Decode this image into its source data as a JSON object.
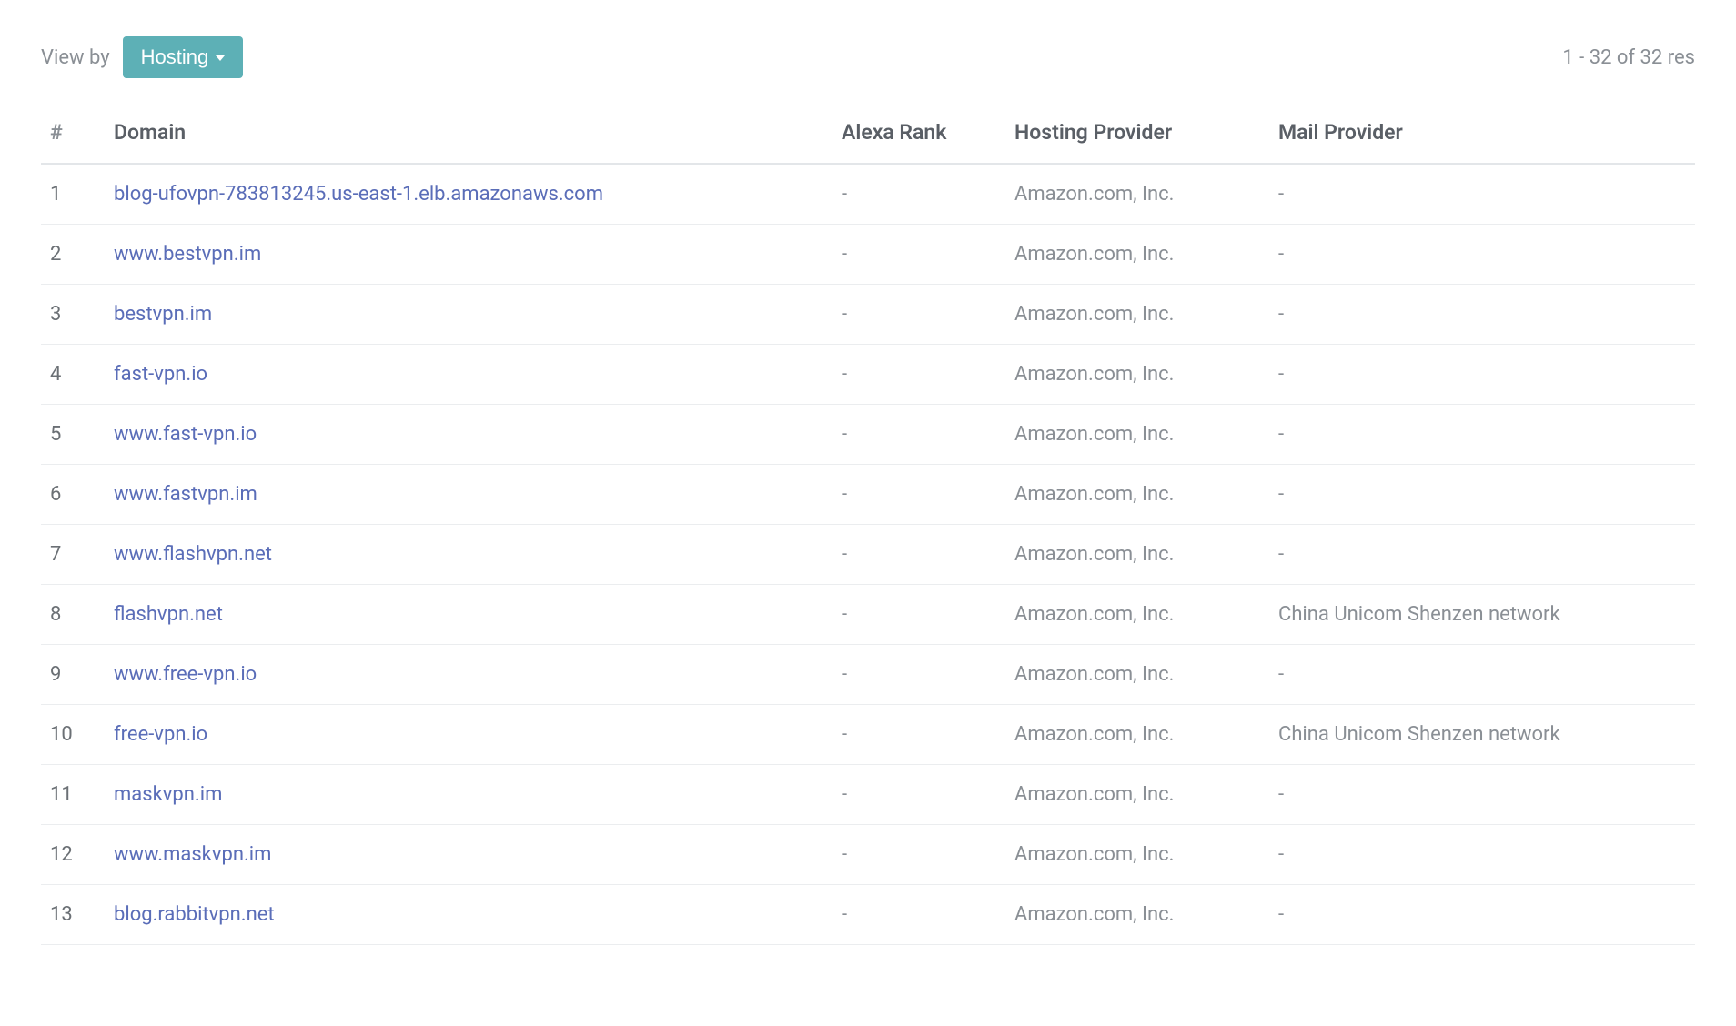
{
  "topbar": {
    "viewby_label": "View by",
    "dropdown_value": "Hosting",
    "result_count": "1 - 32 of 32 res"
  },
  "table": {
    "headers": {
      "index": "#",
      "domain": "Domain",
      "alexa": "Alexa Rank",
      "hosting": "Hosting Provider",
      "mail": "Mail Provider"
    },
    "rows": [
      {
        "index": "1",
        "domain": "blog-ufovpn-783813245.us-east-1.elb.amazonaws.com",
        "alexa": "-",
        "hosting": "Amazon.com, Inc.",
        "mail": "-"
      },
      {
        "index": "2",
        "domain": "www.bestvpn.im",
        "alexa": "-",
        "hosting": "Amazon.com, Inc.",
        "mail": "-"
      },
      {
        "index": "3",
        "domain": "bestvpn.im",
        "alexa": "-",
        "hosting": "Amazon.com, Inc.",
        "mail": "-"
      },
      {
        "index": "4",
        "domain": "fast-vpn.io",
        "alexa": "-",
        "hosting": "Amazon.com, Inc.",
        "mail": "-"
      },
      {
        "index": "5",
        "domain": "www.fast-vpn.io",
        "alexa": "-",
        "hosting": "Amazon.com, Inc.",
        "mail": "-"
      },
      {
        "index": "6",
        "domain": "www.fastvpn.im",
        "alexa": "-",
        "hosting": "Amazon.com, Inc.",
        "mail": "-"
      },
      {
        "index": "7",
        "domain": "www.flashvpn.net",
        "alexa": "-",
        "hosting": "Amazon.com, Inc.",
        "mail": "-"
      },
      {
        "index": "8",
        "domain": "flashvpn.net",
        "alexa": "-",
        "hosting": "Amazon.com, Inc.",
        "mail": "China Unicom Shenzen network"
      },
      {
        "index": "9",
        "domain": "www.free-vpn.io",
        "alexa": "-",
        "hosting": "Amazon.com, Inc.",
        "mail": "-"
      },
      {
        "index": "10",
        "domain": "free-vpn.io",
        "alexa": "-",
        "hosting": "Amazon.com, Inc.",
        "mail": "China Unicom Shenzen network"
      },
      {
        "index": "11",
        "domain": "maskvpn.im",
        "alexa": "-",
        "hosting": "Amazon.com, Inc.",
        "mail": "-"
      },
      {
        "index": "12",
        "domain": "www.maskvpn.im",
        "alexa": "-",
        "hosting": "Amazon.com, Inc.",
        "mail": "-"
      },
      {
        "index": "13",
        "domain": "blog.rabbitvpn.net",
        "alexa": "-",
        "hosting": "Amazon.com, Inc.",
        "mail": "-"
      }
    ]
  }
}
